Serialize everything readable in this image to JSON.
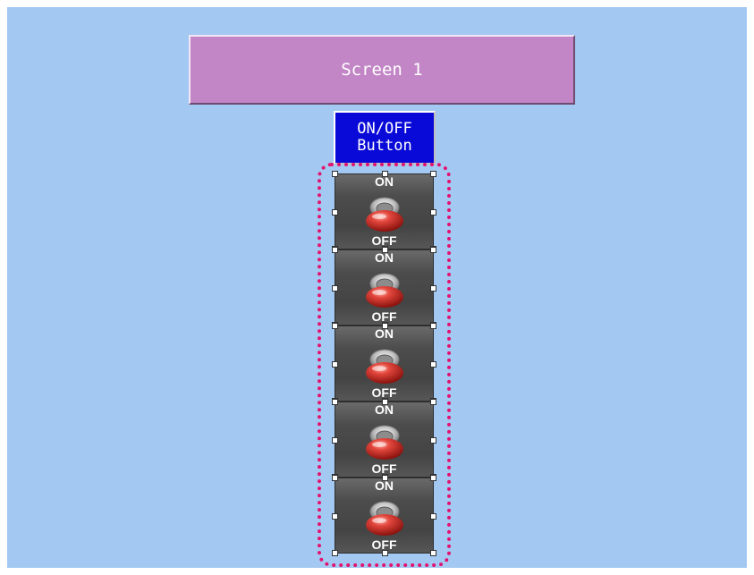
{
  "screen": {
    "title": "Screen 1"
  },
  "component_label": {
    "line1": "ON/OFF",
    "line2": "Button"
  },
  "switches": [
    {
      "on_label": "ON",
      "off_label": "OFF",
      "icon": "toggle-switch-icon"
    },
    {
      "on_label": "ON",
      "off_label": "OFF",
      "icon": "toggle-switch-icon"
    },
    {
      "on_label": "ON",
      "off_label": "OFF",
      "icon": "toggle-switch-icon"
    },
    {
      "on_label": "ON",
      "off_label": "OFF",
      "icon": "toggle-switch-icon"
    },
    {
      "on_label": "ON",
      "off_label": "OFF",
      "icon": "toggle-switch-icon"
    }
  ],
  "colors": {
    "background": "#a3c9f2",
    "title_bar": "#c285c6",
    "label_box": "#0a0ad8",
    "switch_panel": "#4a4a4a",
    "knob": "#d83a34",
    "selection_outline": "#e2126f"
  }
}
